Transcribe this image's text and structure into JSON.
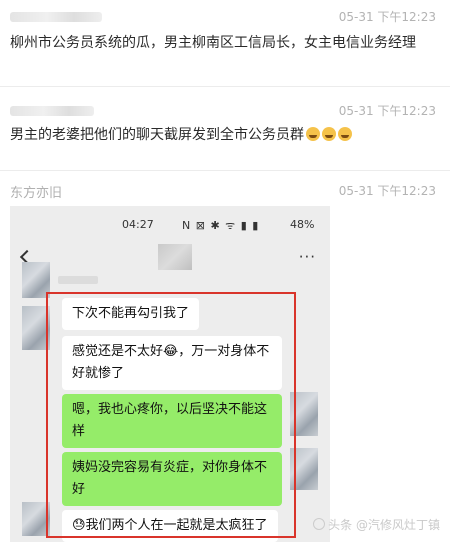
{
  "posts": [
    {
      "time": "05-31 下午12:23",
      "text": "柳州市公务员系统的瓜，男主柳南区工信局长，女主电信业务经理"
    },
    {
      "time": "05-31 下午12:23",
      "text": "男主的老婆把他们的聊天截屏发到全市公务员群",
      "emoji_icons": [
        "sweat-smile-icon",
        "sweat-smile-icon",
        "sweat-smile-icon"
      ]
    },
    {
      "author": "东方亦旧",
      "time": "05-31 下午12:23"
    }
  ],
  "phone": {
    "status": {
      "clock": "04:27",
      "icons": "N ⊠ ✱ ᯤ ▮ ▮",
      "battery": "48%"
    },
    "chat": {
      "back_icon": "chevron-left-icon",
      "more_icon": "ellipsis-icon",
      "more_label": "···"
    },
    "messages": [
      {
        "side": "left",
        "text": "下次不能再勾引我了"
      },
      {
        "side": "left",
        "text": "感觉还是不太好😂，万一对身体不好就惨了"
      },
      {
        "side": "right",
        "text": "嗯，我也心疼你，以后坚决不能这样"
      },
      {
        "side": "right",
        "text": "姨妈没完容易有炎症，对你身体不好"
      },
      {
        "side": "left",
        "text": "😓我们两个人在一起就是太疯狂了"
      }
    ],
    "highlight_color": "#d9342b",
    "bubble_colors": {
      "left": "#ffffff",
      "right": "#95ec69"
    }
  },
  "watermark": "头条 @汽修风灶丁镇"
}
